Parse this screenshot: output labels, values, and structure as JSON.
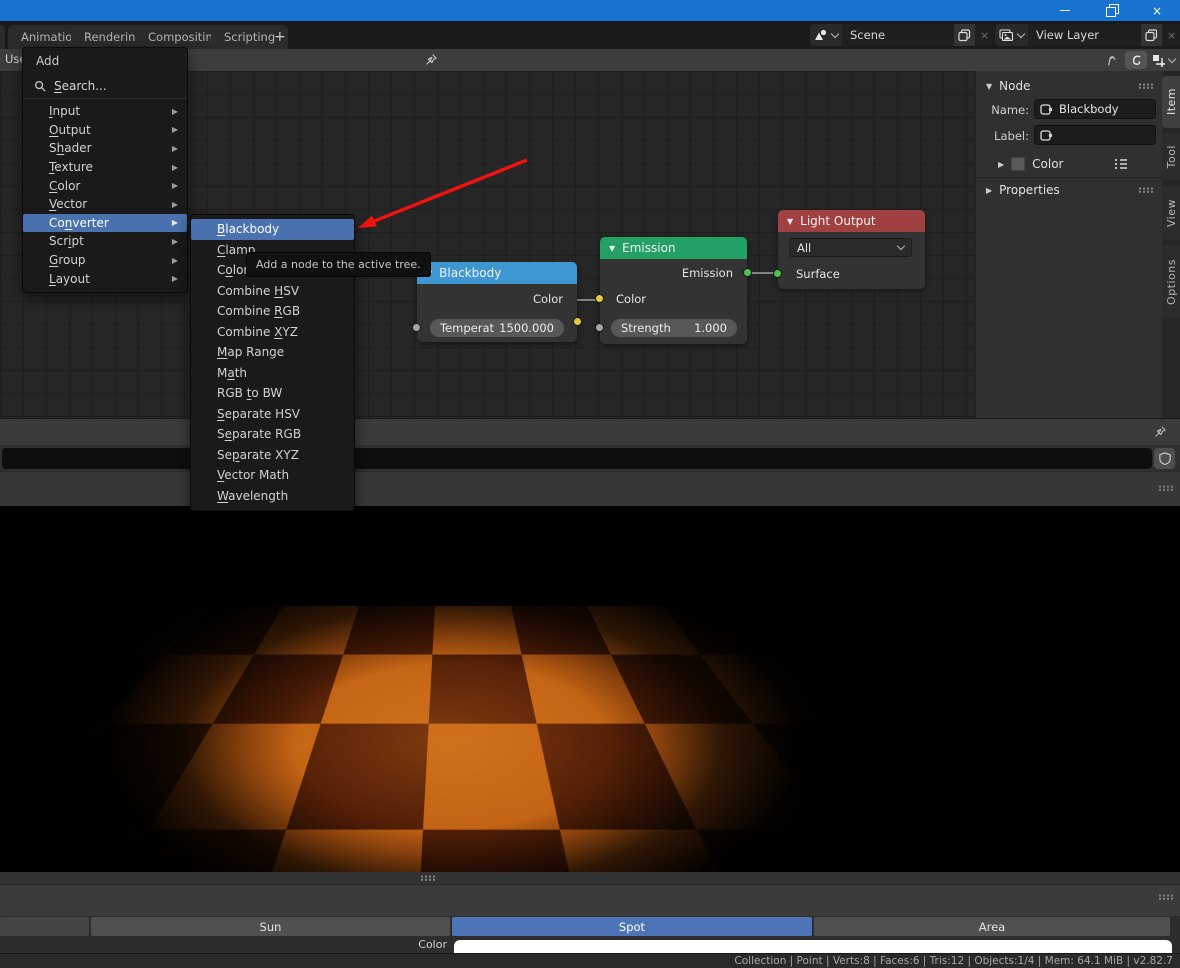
{
  "window": {
    "minimize_icon": "minimize",
    "restore_icon": "restore",
    "close_glyph": "×"
  },
  "topbar": {
    "tabs": [
      {
        "label": "Animation"
      },
      {
        "label": "Rendering"
      },
      {
        "label": "Compositing"
      },
      {
        "label": "Scripting"
      }
    ],
    "add_tab_label": "+",
    "scene": {
      "value": "Scene",
      "clear_glyph": "×"
    },
    "view_layer": {
      "value": "View Layer",
      "clear_glyph": "×"
    }
  },
  "editor_header": {
    "fragment_text": "Use"
  },
  "icons": {
    "tri_down": "▼",
    "tri_right": "▶",
    "submenu_arrow": "▶"
  },
  "add_menu": {
    "title": "Add",
    "search": {
      "accel": "S",
      "rest": "earch..."
    },
    "items": [
      {
        "pre": "",
        "accel": "I",
        "rest": "nput"
      },
      {
        "pre": "",
        "accel": "O",
        "rest": "utput"
      },
      {
        "pre": "S",
        "accel": "h",
        "rest": "ader"
      },
      {
        "pre": "",
        "accel": "T",
        "rest": "exture"
      },
      {
        "pre": "",
        "accel": "C",
        "rest": "olor"
      },
      {
        "pre": "",
        "accel": "V",
        "rest": "ector"
      },
      {
        "pre": "Co",
        "accel": "n",
        "rest": "verter"
      },
      {
        "pre": "Scr",
        "accel": "i",
        "rest": "pt"
      },
      {
        "pre": "",
        "accel": "G",
        "rest": "roup"
      },
      {
        "pre": "",
        "accel": "L",
        "rest": "ayout"
      }
    ],
    "highlighted_item": "Converter"
  },
  "converter_submenu": {
    "items": [
      {
        "pre": "",
        "accel": "B",
        "rest": "lackbody"
      },
      {
        "pre": "",
        "accel": "C",
        "rest": "lamp"
      },
      {
        "pre": "C",
        "accel": "o",
        "rest": "lor"
      },
      {
        "pre": "Combine ",
        "accel": "H",
        "rest": "SV"
      },
      {
        "pre": "Combine ",
        "accel": "R",
        "rest": "GB"
      },
      {
        "pre": "Combine ",
        "accel": "X",
        "rest": "YZ"
      },
      {
        "pre": "",
        "accel": "M",
        "rest": "ap Range"
      },
      {
        "pre": "M",
        "accel": "a",
        "rest": "th"
      },
      {
        "pre": "RGB ",
        "accel": "t",
        "rest": "o BW"
      },
      {
        "pre": "",
        "accel": "S",
        "rest": "eparate HSV"
      },
      {
        "pre": "S",
        "accel": "e",
        "rest": "parate RGB"
      },
      {
        "pre": "Se",
        "accel": "p",
        "rest": "arate XYZ"
      },
      {
        "pre": "",
        "accel": "V",
        "rest": "ector Math"
      },
      {
        "pre": "",
        "accel": "W",
        "rest": "avelength"
      }
    ],
    "highlighted_item": "Blackbody"
  },
  "tooltip": {
    "text": "Add a node to the active tree."
  },
  "nodes": {
    "blackbody": {
      "title": "Blackbody",
      "output_label": "Color",
      "field_label": "Temperat",
      "field_value": "1500.000",
      "header_color": "#3f97d2"
    },
    "emission": {
      "title": "Emission",
      "output_label": "Emission",
      "input_label": "Color",
      "field_label": "Strength",
      "field_value": "1.000",
      "header_color": "#23a164"
    },
    "light_output": {
      "title": "Light Output",
      "dropdown_value": "All",
      "input_label": "Surface",
      "header_color": "#a04040"
    }
  },
  "socket_colors": {
    "yellow": "#e7c842",
    "green": "#4fc14f",
    "gray": "#a5a5a5"
  },
  "sidebar": {
    "node_panel": {
      "title": "Node",
      "name_label": "Name:",
      "name_value": "Blackbody",
      "label_label": "Label:",
      "label_value": "",
      "color_row_label": "Color"
    },
    "properties_panel": {
      "title": "Properties"
    },
    "tabs": [
      {
        "label": "Item"
      },
      {
        "label": "Tool"
      },
      {
        "label": "View"
      },
      {
        "label": "Options"
      }
    ],
    "active_tab": "Item"
  },
  "bottom": {
    "buttons": [
      {
        "label": ""
      },
      {
        "label": "Sun"
      },
      {
        "label": "Spot"
      },
      {
        "label": "Area"
      }
    ],
    "active_button": "Spot",
    "color_label": "Color"
  },
  "status_bar": {
    "text": "Collection | Point | Verts:8 | Faces:6 | Tris:12 | Objects:1/4 | Mem: 64.1 MiB | v2.82.7"
  },
  "annotation": {
    "arrow_color": "#ee1310"
  },
  "colors": {
    "selection_blue": "#4a72b0",
    "titlebar_blue": "#1872cf",
    "spot_button_blue": "#4e74b8",
    "checker_light": "#bd5f15",
    "checker_dark": "#4d1e07"
  }
}
